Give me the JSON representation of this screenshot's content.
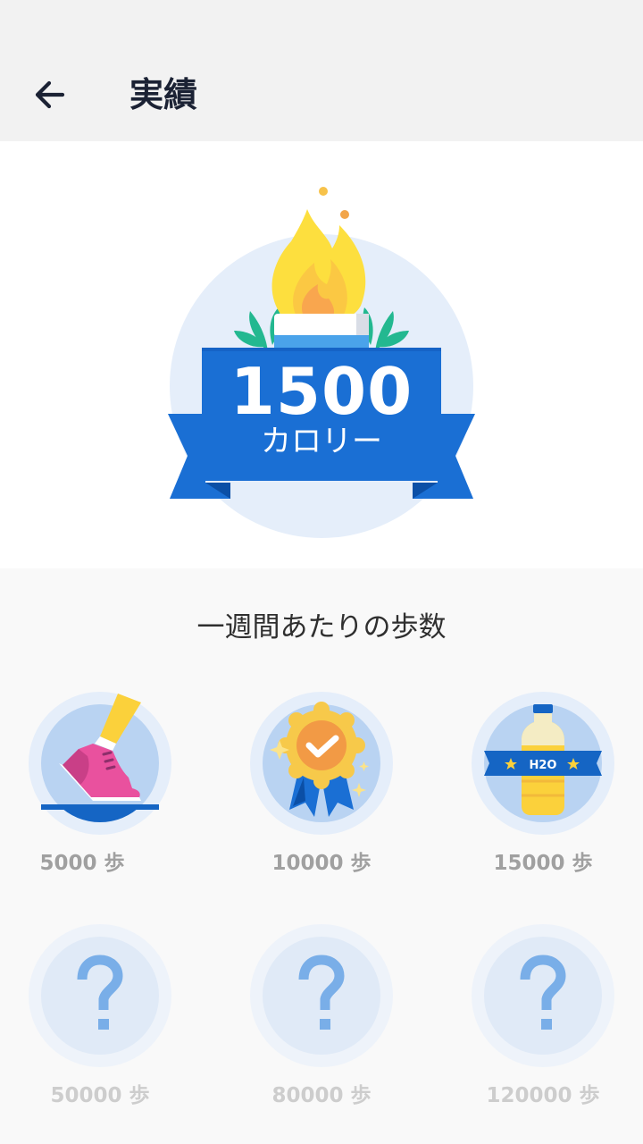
{
  "header": {
    "title": "実績",
    "back_icon": "arrow-left-icon"
  },
  "hero": {
    "value": "1500",
    "unit": "カロリー",
    "icon": "torch-flame-icon",
    "colors": {
      "ribbon": "#1a6fd4",
      "ribbon_dark": "#0e58b8",
      "flame_outer": "#fddf3e",
      "flame_inner": "#f9a64e",
      "leaf": "#23b890",
      "disc": "#e5eefa"
    }
  },
  "section": {
    "title": "一週間あたりの歩数"
  },
  "badges": [
    {
      "label": "5000 歩",
      "icon": "sneaker-icon",
      "unlocked": true
    },
    {
      "label": "10000 歩",
      "icon": "medal-check-icon",
      "unlocked": true
    },
    {
      "label": "15000 歩",
      "icon": "water-bottle-icon",
      "unlocked": true,
      "bottle_text": "H2O"
    },
    {
      "label": "50000 歩",
      "icon": "question-mark-icon",
      "unlocked": false
    },
    {
      "label": "80000 歩",
      "icon": "question-mark-icon",
      "unlocked": false
    },
    {
      "label": "120000 歩",
      "icon": "question-mark-icon",
      "unlocked": false
    }
  ]
}
